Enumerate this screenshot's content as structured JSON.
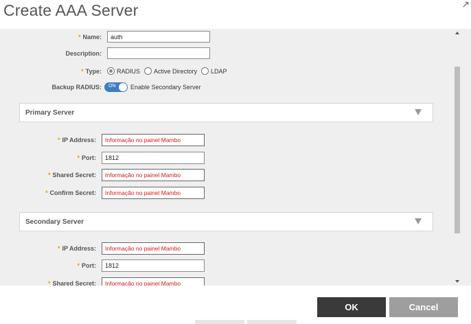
{
  "dialog": {
    "title": "Create AAA Server",
    "close_glyph": "↗"
  },
  "form": {
    "name_label": "Name:",
    "name_value": "auth",
    "description_label": "Description:",
    "description_value": "",
    "type_label": "Type:",
    "type_options": [
      "RADIUS",
      "Active Directory",
      "LDAP"
    ],
    "type_selected": "RADIUS",
    "backup_label": "Backup RADIUS:",
    "backup_toggle": "ON",
    "backup_text": "Enable Secondary Server",
    "required_mark": "*"
  },
  "primary": {
    "title": "Primary Server",
    "ip_label": "IP Address:",
    "ip_value": "Informação no painel Mambo",
    "port_label": "Port:",
    "port_value": "1812",
    "secret_label": "Shared Secret:",
    "secret_value": "Informação no painel  Mambo",
    "confirm_label": "Confirm Secret:",
    "confirm_value": "Informação no painel Mambo"
  },
  "secondary": {
    "title": "Secondary Server",
    "ip_label": "IP Address:",
    "ip_value": "Informação no painel  Mambo",
    "port_label": "Port:",
    "port_value": "1812",
    "secret_label": "Shared Secret:",
    "secret_value": "Informação no painel Mambo"
  },
  "footer": {
    "ok_label": "OK",
    "cancel_label": "Cancel"
  },
  "colors": {
    "toggle_on": "#3d7ec1",
    "required": "#e8a000",
    "error_text": "#d21414",
    "ok_bg": "#3a3a3a",
    "cancel_bg": "#9e9e9e"
  }
}
